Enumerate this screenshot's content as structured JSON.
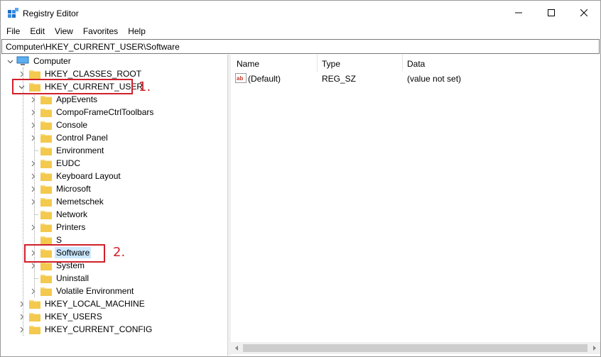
{
  "window": {
    "title": "Registry Editor",
    "controls": {
      "minimize": "minimize-icon",
      "maximize": "maximize-icon",
      "close": "close-icon"
    }
  },
  "menu": [
    "File",
    "Edit",
    "View",
    "Favorites",
    "Help"
  ],
  "address": "Computer\\HKEY_CURRENT_USER\\Software",
  "tree": {
    "root": "Computer",
    "hives": [
      "HKEY_CLASSES_ROOT",
      "HKEY_CURRENT_USER",
      "HKEY_LOCAL_MACHINE",
      "HKEY_USERS",
      "HKEY_CURRENT_CONFIG"
    ],
    "current_user_children": [
      "AppEvents",
      "CompoFrameCtrlToolbars",
      "Console",
      "Control Panel",
      "Environment",
      "EUDC",
      "Keyboard Layout",
      "Microsoft",
      "Nemetschek",
      "Network",
      "Printers",
      "S",
      "Software",
      "System",
      "Uninstall",
      "Volatile Environment"
    ],
    "selected": "Software"
  },
  "annotations": {
    "step1": "1.",
    "step2": "2."
  },
  "list": {
    "columns": [
      "Name",
      "Type",
      "Data"
    ],
    "rows": [
      {
        "name": "(Default)",
        "type": "REG_SZ",
        "data": "(value not set)",
        "icon": "string-value-icon"
      }
    ]
  },
  "colors": {
    "annotation": "#d0202a",
    "selection": "#cce8ff",
    "folder": "#f8d775"
  }
}
